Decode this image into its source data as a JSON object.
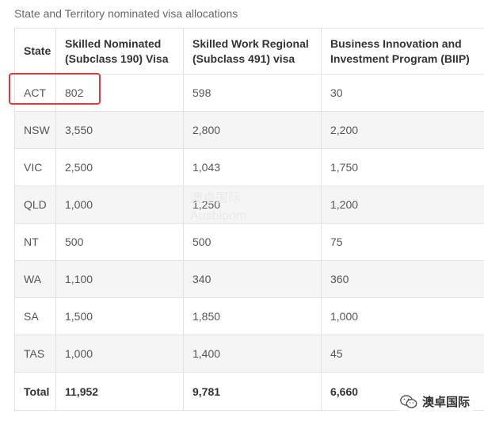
{
  "caption": "State and Territory nominated visa allocations",
  "table": {
    "headers": [
      "State",
      "Skilled Nominated (Subclass 190) Visa",
      "Skilled Work Regional (Subclass 491) visa",
      "Business Innovation and Investment Program (BIIP)"
    ],
    "rows": [
      [
        "ACT",
        "802",
        "598",
        "30"
      ],
      [
        "NSW",
        "3,550",
        "2,800",
        "2,200"
      ],
      [
        "VIC",
        "2,500",
        "1,043",
        "1,750"
      ],
      [
        "QLD",
        "1,000",
        "1,250",
        "1,200"
      ],
      [
        "NT",
        "500",
        "500",
        "75"
      ],
      [
        "WA",
        "1,100",
        "340",
        "360"
      ],
      [
        "SA",
        "1,500",
        "1,850",
        "1,000"
      ],
      [
        "TAS",
        "1,000",
        "1,400",
        "45"
      ]
    ],
    "total": [
      "Total",
      "11,952",
      "9,781",
      "6,660"
    ]
  },
  "highlight_color": "#e0393e",
  "watermark": {
    "line1": "澳卓国际",
    "line2": "Ausbloom"
  },
  "wechat": {
    "icon": "wechat-icon",
    "label": "澳卓国际"
  }
}
